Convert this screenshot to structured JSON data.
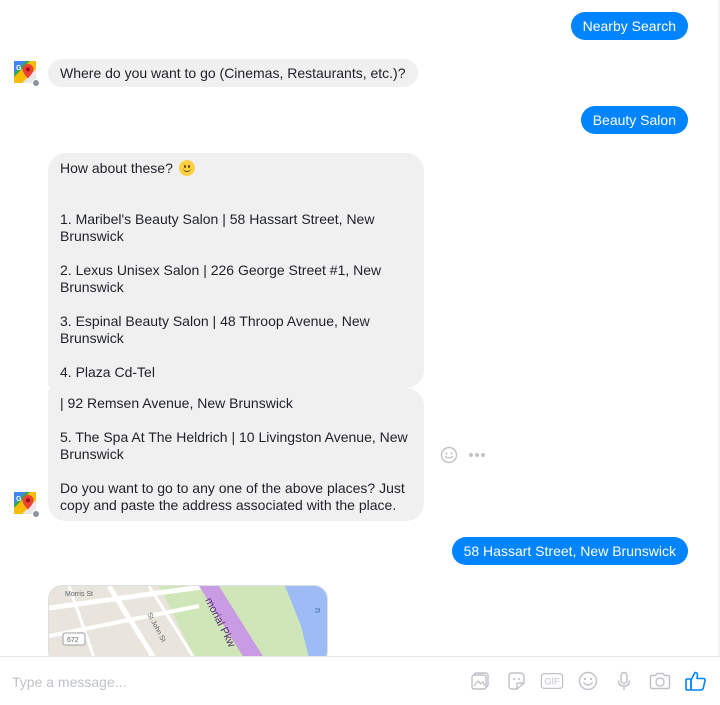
{
  "messages": {
    "out1": "Nearby Search",
    "in1": "Where do you want to go (Cinemas, Restaurants, etc.)?",
    "out2": "Beauty Salon",
    "in2": {
      "intro": "How about these?",
      "item1": "1. Maribel's Beauty Salon | 58 Hassart Street, New Brunswick",
      "item2": "2. Lexus Unisex Salon | 226 George Street #1, New Brunswick",
      "item3": "3. Espinal Beauty Salon | 48 Throop Avenue, New Brunswick",
      "item4": "4. Plaza Cd-Tel"
    },
    "in3": {
      "line1": "| 92 Remsen Avenue, New Brunswick",
      "item5": "5. The Spa At The Heldrich | 10 Livingston Avenue, New Brunswick",
      "question": "Do you want to go to any one of the above places? Just copy and paste the address associated with the place."
    },
    "out3": "58 Hassart Street, New Brunswick"
  },
  "map": {
    "labels": {
      "morris_st": "Morris St",
      "st_john_st": "St John St",
      "route": "672",
      "memorial_pkwy": "morial Pkw",
      "river": "n"
    }
  },
  "composer": {
    "placeholder": "Type a message..."
  },
  "icons": {
    "avatar": "google-maps-icon",
    "emoji_in_text": "slightly-smiling-face-icon",
    "reaction": "smiley-icon",
    "more": "more-dots-icon",
    "tools": [
      "image-icon",
      "sticker-icon",
      "gif-icon",
      "emoji-icon",
      "microphone-icon",
      "camera-icon",
      "thumbs-up-icon"
    ],
    "gif_label": "GIF"
  },
  "colors": {
    "outgoing": "#0084ff",
    "incoming": "#f1f0f0",
    "accent": "#0084ff"
  }
}
